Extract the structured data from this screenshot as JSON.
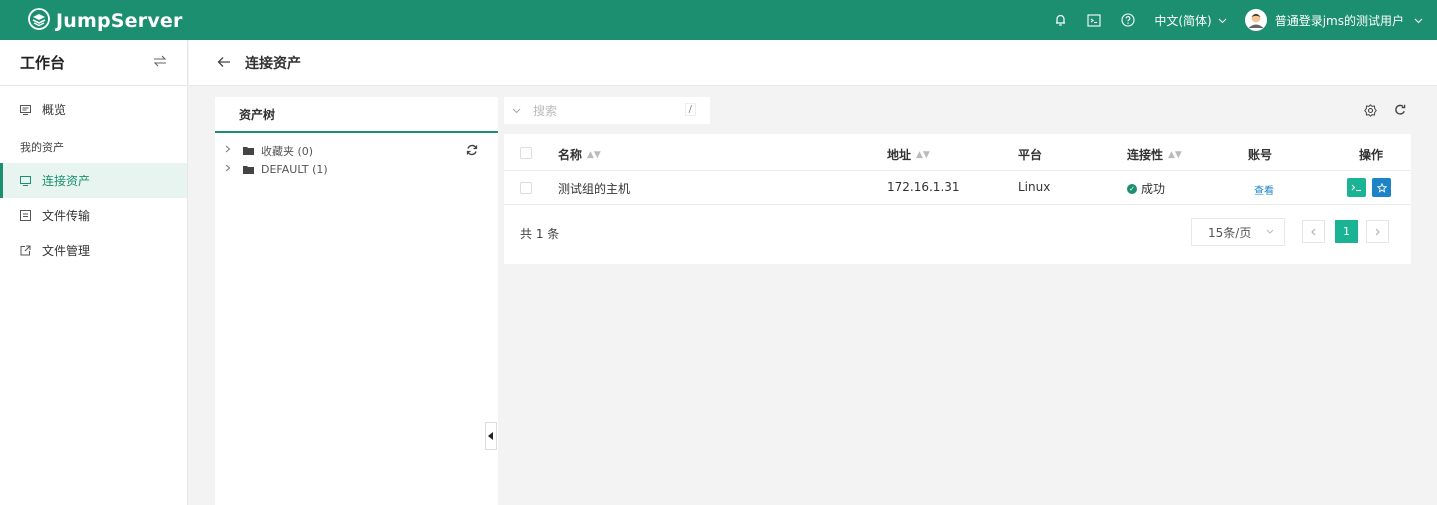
{
  "header": {
    "brand": "JumpServer",
    "language": "中文(简体)",
    "username": "普通登录jms的测试用户",
    "icons": [
      "bell-icon",
      "terminal-icon",
      "help-icon"
    ]
  },
  "sidebar": {
    "title": "工作台",
    "overview": "概览",
    "section": "我的资产",
    "items": [
      {
        "label": "连接资产",
        "icon": "monitor-icon",
        "active": true
      },
      {
        "label": "文件传输",
        "icon": "file-transfer-icon",
        "active": false
      },
      {
        "label": "文件管理",
        "icon": "external-link-icon",
        "active": false
      }
    ]
  },
  "page": {
    "title": "连接资产"
  },
  "tree": {
    "tab_label": "资产树",
    "nodes": [
      {
        "label": "收藏夹 (0)"
      },
      {
        "label": "DEFAULT (1)"
      }
    ]
  },
  "search": {
    "placeholder": "搜索",
    "shortcut": "/"
  },
  "table": {
    "columns": {
      "name": "名称",
      "address": "地址",
      "platform": "平台",
      "connectivity": "连接性",
      "account": "账号",
      "actions": "操作"
    },
    "rows": [
      {
        "name": "测试组的主机",
        "address": "172.16.1.31",
        "platform": "Linux",
        "connectivity": "成功",
        "account": "查看"
      }
    ],
    "total": "共 1 条",
    "page_size": "15条/页",
    "current_page": "1"
  },
  "colors": {
    "brand": "#1b8f70",
    "action_green": "#1ab394",
    "action_blue": "#1c84c6"
  }
}
